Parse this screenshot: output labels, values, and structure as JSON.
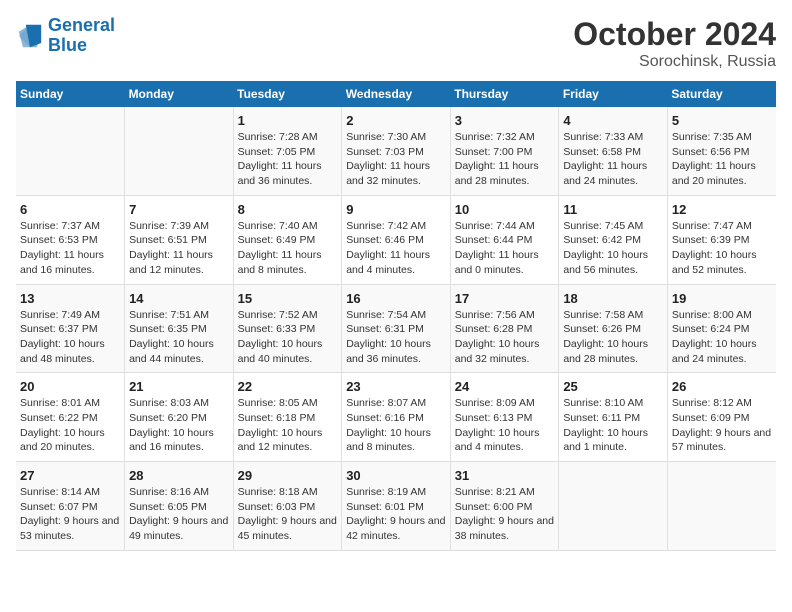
{
  "header": {
    "logo_line1": "General",
    "logo_line2": "Blue",
    "month": "October 2024",
    "location": "Sorochinsk, Russia"
  },
  "days_of_week": [
    "Sunday",
    "Monday",
    "Tuesday",
    "Wednesday",
    "Thursday",
    "Friday",
    "Saturday"
  ],
  "weeks": [
    [
      {
        "day": "",
        "info": ""
      },
      {
        "day": "",
        "info": ""
      },
      {
        "day": "1",
        "info": "Sunrise: 7:28 AM\nSunset: 7:05 PM\nDaylight: 11 hours and 36 minutes."
      },
      {
        "day": "2",
        "info": "Sunrise: 7:30 AM\nSunset: 7:03 PM\nDaylight: 11 hours and 32 minutes."
      },
      {
        "day": "3",
        "info": "Sunrise: 7:32 AM\nSunset: 7:00 PM\nDaylight: 11 hours and 28 minutes."
      },
      {
        "day": "4",
        "info": "Sunrise: 7:33 AM\nSunset: 6:58 PM\nDaylight: 11 hours and 24 minutes."
      },
      {
        "day": "5",
        "info": "Sunrise: 7:35 AM\nSunset: 6:56 PM\nDaylight: 11 hours and 20 minutes."
      }
    ],
    [
      {
        "day": "6",
        "info": "Sunrise: 7:37 AM\nSunset: 6:53 PM\nDaylight: 11 hours and 16 minutes."
      },
      {
        "day": "7",
        "info": "Sunrise: 7:39 AM\nSunset: 6:51 PM\nDaylight: 11 hours and 12 minutes."
      },
      {
        "day": "8",
        "info": "Sunrise: 7:40 AM\nSunset: 6:49 PM\nDaylight: 11 hours and 8 minutes."
      },
      {
        "day": "9",
        "info": "Sunrise: 7:42 AM\nSunset: 6:46 PM\nDaylight: 11 hours and 4 minutes."
      },
      {
        "day": "10",
        "info": "Sunrise: 7:44 AM\nSunset: 6:44 PM\nDaylight: 11 hours and 0 minutes."
      },
      {
        "day": "11",
        "info": "Sunrise: 7:45 AM\nSunset: 6:42 PM\nDaylight: 10 hours and 56 minutes."
      },
      {
        "day": "12",
        "info": "Sunrise: 7:47 AM\nSunset: 6:39 PM\nDaylight: 10 hours and 52 minutes."
      }
    ],
    [
      {
        "day": "13",
        "info": "Sunrise: 7:49 AM\nSunset: 6:37 PM\nDaylight: 10 hours and 48 minutes."
      },
      {
        "day": "14",
        "info": "Sunrise: 7:51 AM\nSunset: 6:35 PM\nDaylight: 10 hours and 44 minutes."
      },
      {
        "day": "15",
        "info": "Sunrise: 7:52 AM\nSunset: 6:33 PM\nDaylight: 10 hours and 40 minutes."
      },
      {
        "day": "16",
        "info": "Sunrise: 7:54 AM\nSunset: 6:31 PM\nDaylight: 10 hours and 36 minutes."
      },
      {
        "day": "17",
        "info": "Sunrise: 7:56 AM\nSunset: 6:28 PM\nDaylight: 10 hours and 32 minutes."
      },
      {
        "day": "18",
        "info": "Sunrise: 7:58 AM\nSunset: 6:26 PM\nDaylight: 10 hours and 28 minutes."
      },
      {
        "day": "19",
        "info": "Sunrise: 8:00 AM\nSunset: 6:24 PM\nDaylight: 10 hours and 24 minutes."
      }
    ],
    [
      {
        "day": "20",
        "info": "Sunrise: 8:01 AM\nSunset: 6:22 PM\nDaylight: 10 hours and 20 minutes."
      },
      {
        "day": "21",
        "info": "Sunrise: 8:03 AM\nSunset: 6:20 PM\nDaylight: 10 hours and 16 minutes."
      },
      {
        "day": "22",
        "info": "Sunrise: 8:05 AM\nSunset: 6:18 PM\nDaylight: 10 hours and 12 minutes."
      },
      {
        "day": "23",
        "info": "Sunrise: 8:07 AM\nSunset: 6:16 PM\nDaylight: 10 hours and 8 minutes."
      },
      {
        "day": "24",
        "info": "Sunrise: 8:09 AM\nSunset: 6:13 PM\nDaylight: 10 hours and 4 minutes."
      },
      {
        "day": "25",
        "info": "Sunrise: 8:10 AM\nSunset: 6:11 PM\nDaylight: 10 hours and 1 minute."
      },
      {
        "day": "26",
        "info": "Sunrise: 8:12 AM\nSunset: 6:09 PM\nDaylight: 9 hours and 57 minutes."
      }
    ],
    [
      {
        "day": "27",
        "info": "Sunrise: 8:14 AM\nSunset: 6:07 PM\nDaylight: 9 hours and 53 minutes."
      },
      {
        "day": "28",
        "info": "Sunrise: 8:16 AM\nSunset: 6:05 PM\nDaylight: 9 hours and 49 minutes."
      },
      {
        "day": "29",
        "info": "Sunrise: 8:18 AM\nSunset: 6:03 PM\nDaylight: 9 hours and 45 minutes."
      },
      {
        "day": "30",
        "info": "Sunrise: 8:19 AM\nSunset: 6:01 PM\nDaylight: 9 hours and 42 minutes."
      },
      {
        "day": "31",
        "info": "Sunrise: 8:21 AM\nSunset: 6:00 PM\nDaylight: 9 hours and 38 minutes."
      },
      {
        "day": "",
        "info": ""
      },
      {
        "day": "",
        "info": ""
      }
    ]
  ]
}
